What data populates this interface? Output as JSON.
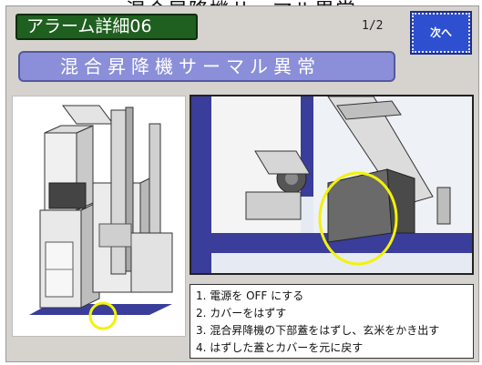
{
  "caption": "混合昇降機サーマル異常",
  "header": {
    "title": "アラーム詳細06",
    "page": "1/2",
    "next_label": "次へ"
  },
  "alarm": {
    "name": "混合昇降機サーマル異常"
  },
  "steps": [
    "1. 電源を OFF にする",
    "2. カバーをはずす",
    "3. 混合昇降機の下部蓋をはずし、玄米をかき出す",
    "4. はずした蓋とカバーを元に戻す"
  ],
  "colors": {
    "title_bg": "#1f5f1f",
    "subtitle_bg": "#8b8fd9",
    "next_bg": "#2e4fd0",
    "highlight": "#f2f20a"
  }
}
